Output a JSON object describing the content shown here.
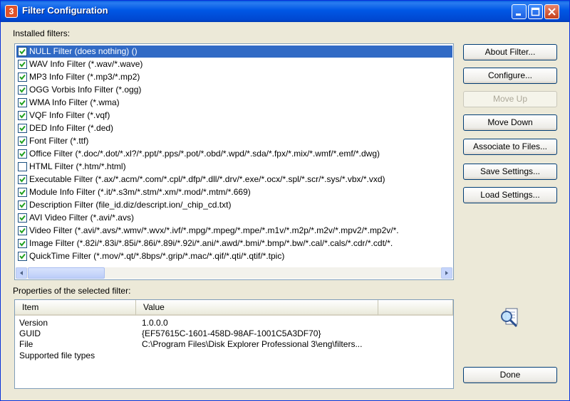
{
  "window": {
    "title": "Filter Configuration",
    "app_icon_glyph": "3",
    "controls": [
      "minimize-icon",
      "maximize-icon",
      "close-icon"
    ]
  },
  "installed_label": "Installed filters:",
  "filters": [
    {
      "label": "NULL Filter (does nothing) ()",
      "checked": true,
      "selected": true
    },
    {
      "label": "WAV Info Filter (*.wav/*.wave)",
      "checked": true
    },
    {
      "label": "MP3 Info Filter (*.mp3/*.mp2)",
      "checked": true
    },
    {
      "label": "OGG Vorbis Info Filter (*.ogg)",
      "checked": true
    },
    {
      "label": "WMA Info Filter (*.wma)",
      "checked": true
    },
    {
      "label": "VQF Info Filter (*.vqf)",
      "checked": true
    },
    {
      "label": "DED Info Filter (*.ded)",
      "checked": true
    },
    {
      "label": "Font Filter (*.ttf)",
      "checked": true
    },
    {
      "label": "Office Filter (*.doc/*.dot/*.xl?/*.ppt/*.pps/*.pot/*.obd/*.wpd/*.sda/*.fpx/*.mix/*.wmf/*.emf/*.dwg)",
      "checked": true
    },
    {
      "label": "HTML Filter (*.htm/*.html)",
      "checked": false
    },
    {
      "label": "Executable Filter (*.ax/*.acm/*.com/*.cpl/*.dfp/*.dll/*.drv/*.exe/*.ocx/*.spl/*.scr/*.sys/*.vbx/*.vxd)",
      "checked": true
    },
    {
      "label": "Module Info Filter (*.it/*.s3m/*.stm/*.xm/*.mod/*.mtm/*.669)",
      "checked": true
    },
    {
      "label": "Description Filter (file_id.diz/descript.ion/_chip_cd.txt)",
      "checked": true
    },
    {
      "label": "AVI Video Filter (*.avi/*.avs)",
      "checked": true
    },
    {
      "label": "Video Filter (*.avi/*.avs/*.wmv/*.wvx/*.ivf/*.mpg/*.mpeg/*.mpe/*.m1v/*.m2p/*.m2v/*.mpv2/*.mp2v/*.",
      "checked": true
    },
    {
      "label": "Image Filter (*.82i/*.83i/*.85i/*.86i/*.89i/*.92i/*.ani/*.awd/*.bmi/*.bmp/*.bw/*.cal/*.cals/*.cdr/*.cdt/*.",
      "checked": true
    },
    {
      "label": "QuickTime Filter (*.mov/*.qt/*.8bps/*.grip/*.mac/*.qif/*.qti/*.qtif/*.tpic)",
      "checked": true
    }
  ],
  "buttons": {
    "about": "About Filter...",
    "configure": "Configure...",
    "move_up": "Move Up",
    "move_down": "Move Down",
    "associate": "Associate to Files...",
    "save": "Save Settings...",
    "load": "Load Settings...",
    "done": "Done"
  },
  "properties_label": "Properties of the selected filter:",
  "properties": {
    "headers": [
      "Item",
      "Value"
    ],
    "rows": [
      {
        "item": "Version",
        "value": "1.0.0.0"
      },
      {
        "item": "GUID",
        "value": "{EF57615C-1601-458D-98AF-1001C5A3DF70}"
      },
      {
        "item": "File",
        "value": "C:\\Program Files\\Disk Explorer Professional 3\\eng\\filters..."
      },
      {
        "item": "Supported file types",
        "value": ""
      }
    ]
  },
  "colors": {
    "titlebar": "#0054e3",
    "selection": "#316ac5",
    "dialog_bg": "#ece9d8"
  }
}
